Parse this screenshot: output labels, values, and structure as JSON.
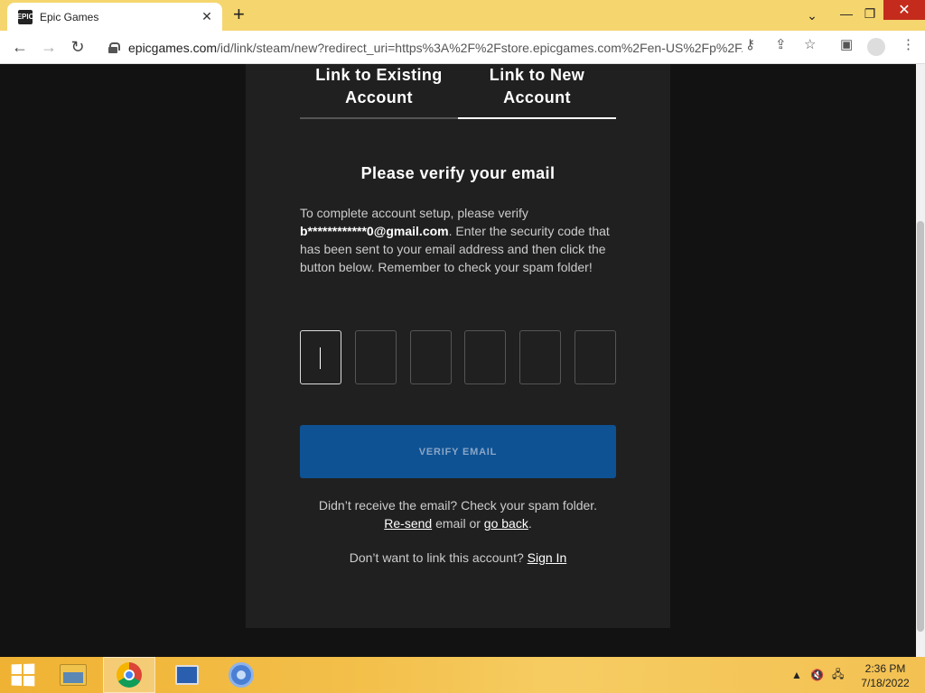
{
  "browser": {
    "tab_title": "Epic Games",
    "tab_favicon": "epic-games-favicon",
    "new_tab_label": "+",
    "url_host": "epicgames.com",
    "url_path": "/id/link/steam/new?redirect_uri=https%3A%2F%2Fstore.epicgames.com%2Fen-US%2Fp%2F..."
  },
  "page": {
    "tabs": [
      {
        "label": "Link to Existing Account",
        "active": false
      },
      {
        "label": "Link to New Account",
        "active": true
      }
    ],
    "heading": "Please verify your email",
    "desc_before": "To complete account setup, please verify ",
    "masked_email": "b************0@gmail.com",
    "desc_after": ". Enter the security code that has been sent to your email address and then click the button below. Remember to check your spam folder!",
    "code_fields": [
      "",
      "",
      "",
      "",
      "",
      ""
    ],
    "verify_button": "VERIFY EMAIL",
    "resend_prefix": "Didn’t receive the email? Check your spam folder.",
    "resend_link": "Re-send",
    "resend_middle": " email or ",
    "go_back_link": "go back",
    "resend_suffix": ".",
    "signin_prefix": "Don’t want to link this account? ",
    "signin_link": "Sign In"
  },
  "taskbar": {
    "time": "2:36 PM",
    "date": "7/18/2022"
  },
  "colors": {
    "card_bg": "#202020",
    "verify_button_bg": "#0e5294",
    "tab_strip": "#f5d56e"
  }
}
